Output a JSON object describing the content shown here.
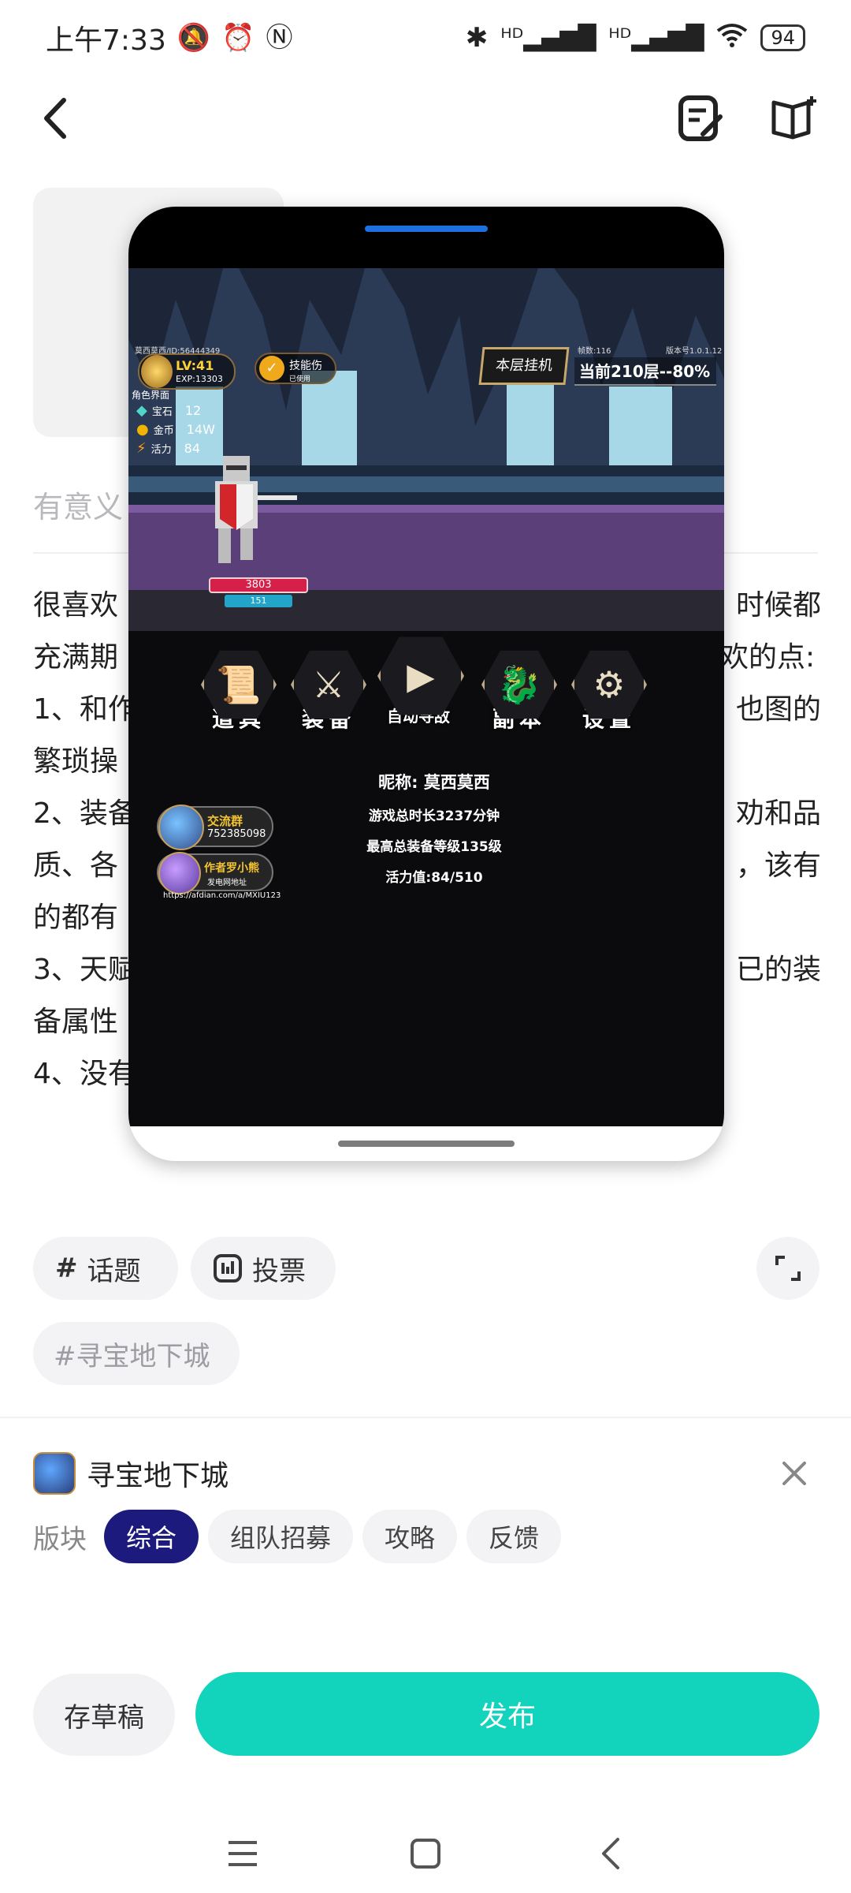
{
  "status_bar": {
    "time": "上午7:33",
    "battery": "94",
    "icons": [
      "mute-icon",
      "alarm-icon",
      "nfc-icon",
      "bluetooth-icon",
      "signal-hd-icon",
      "signal-hd-icon",
      "wifi-icon",
      "battery-icon"
    ]
  },
  "editor": {
    "title_placeholder": "有意义",
    "body_lines": [
      "很喜欢",
      "充满期",
      "1、和作",
      "繁琐操",
      "2、装备",
      "质、各",
      "的都有",
      "3、天赋",
      "备属性",
      "4、没有"
    ],
    "body_right_fragments": [
      "时候都",
      "欢的点:",
      "也图的",
      "",
      "劝和品",
      "，该有",
      "",
      "已的装",
      "",
      ""
    ]
  },
  "game_overlay": {
    "player_id": "莫西莫西/ID:56444349",
    "level": "LV:41",
    "exp": "EXP:13303",
    "role_label": "角色界面",
    "gem_label": "宝石",
    "gem_value": "12",
    "gold_label": "金币",
    "gold_value": "14W",
    "energy_label": "活力",
    "energy_value": "84",
    "skill_injury": "技能伤",
    "skill_used": "已使用",
    "floor_button": "本层挂机",
    "frame_rate": "帧数:116",
    "version": "版本号1.0.1.12",
    "floor_progress": "当前210层--80%",
    "hp": "3803",
    "mp": "151",
    "menu": [
      {
        "label": "道具",
        "icon": "scroll-icon"
      },
      {
        "label": "装备",
        "icon": "sword-icon"
      },
      {
        "label": "自动寻敌",
        "icon": "play-icon"
      },
      {
        "label": "副本",
        "icon": "dragon-icon"
      },
      {
        "label": "设置",
        "icon": "gear-icon"
      }
    ],
    "community_title": "交流群",
    "community_number": "752385098",
    "author_title": "作者罗小熊",
    "author_subtitle": "发电网地址",
    "author_url": "https://afdian.com/a/MXIU123",
    "nickname": "昵称:  莫西莫西",
    "total_time": "游戏总时长3237分钟",
    "max_equip_level": "最高总装备等级135级",
    "energy_value_line": "活力值:84/510"
  },
  "tools": {
    "topic": "话题",
    "vote": "投票",
    "tag": "#寻宝地下城"
  },
  "game_link": {
    "name": "寻宝地下城"
  },
  "board": {
    "label": "版块",
    "options": [
      "综合",
      "组队招募",
      "攻略",
      "反馈"
    ],
    "selected": "综合"
  },
  "actions": {
    "draft": "存草稿",
    "publish": "发布"
  },
  "colors": {
    "publish": "#12d3bb",
    "active_board": "#1d1a7e",
    "drag_handle": "#1e6fe0"
  }
}
